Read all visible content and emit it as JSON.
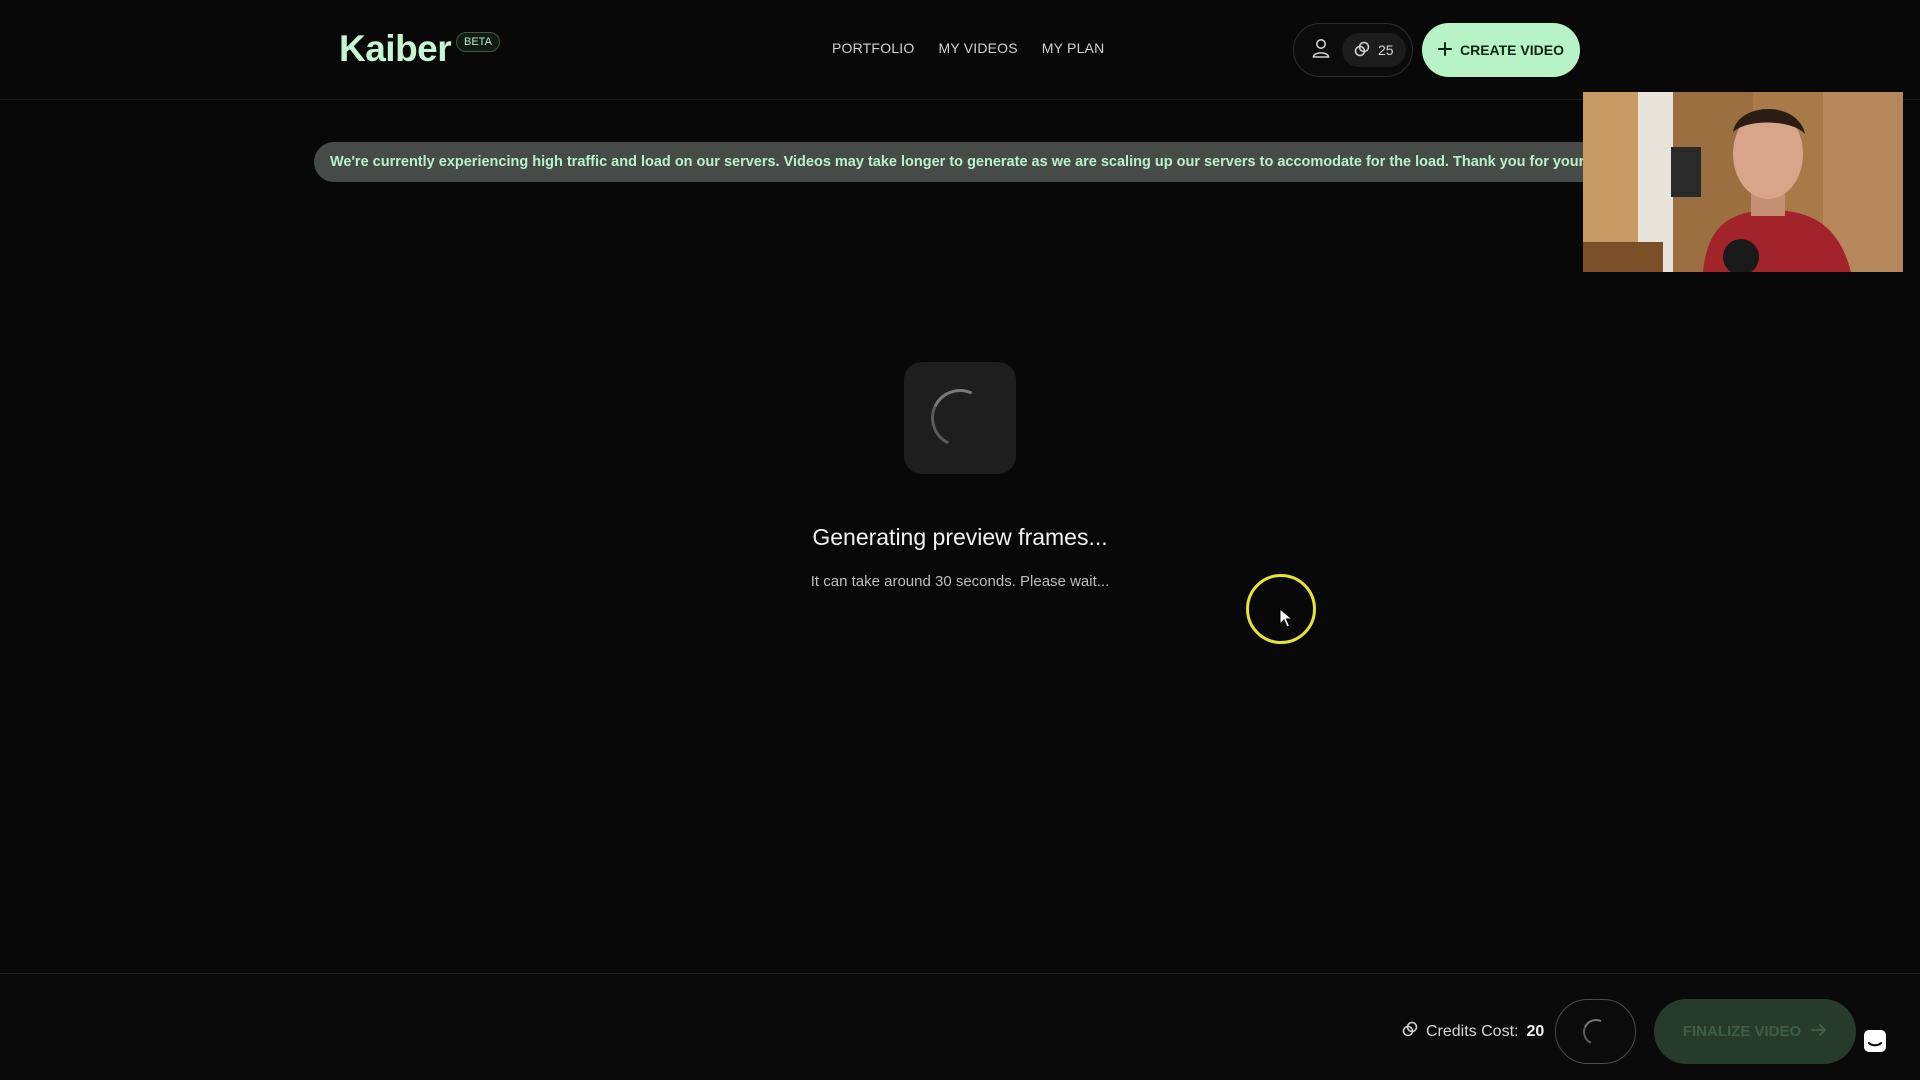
{
  "header": {
    "logo": "Kaiber",
    "beta_badge": "BETA",
    "nav": [
      "PORTFOLIO",
      "MY VIDEOS",
      "MY PLAN"
    ],
    "credits_balance": "25",
    "create_label": "CREATE VIDEO"
  },
  "banner": {
    "text": "We're currently experiencing high traffic and load on our servers. Videos may take longer to generate as we are scaling up our servers to accomodate for the load. Thank you for your patience."
  },
  "main": {
    "title": "Generating preview frames...",
    "subtitle": "It can take around 30 seconds. Please wait..."
  },
  "footer": {
    "credits_cost_label": "Credits Cost:",
    "credits_cost_value": "20",
    "finalize_label": "FINALIZE VIDEO"
  },
  "colors": {
    "accent": "#b7f3c6",
    "background": "#080808",
    "banner_bg": "#474b48"
  }
}
